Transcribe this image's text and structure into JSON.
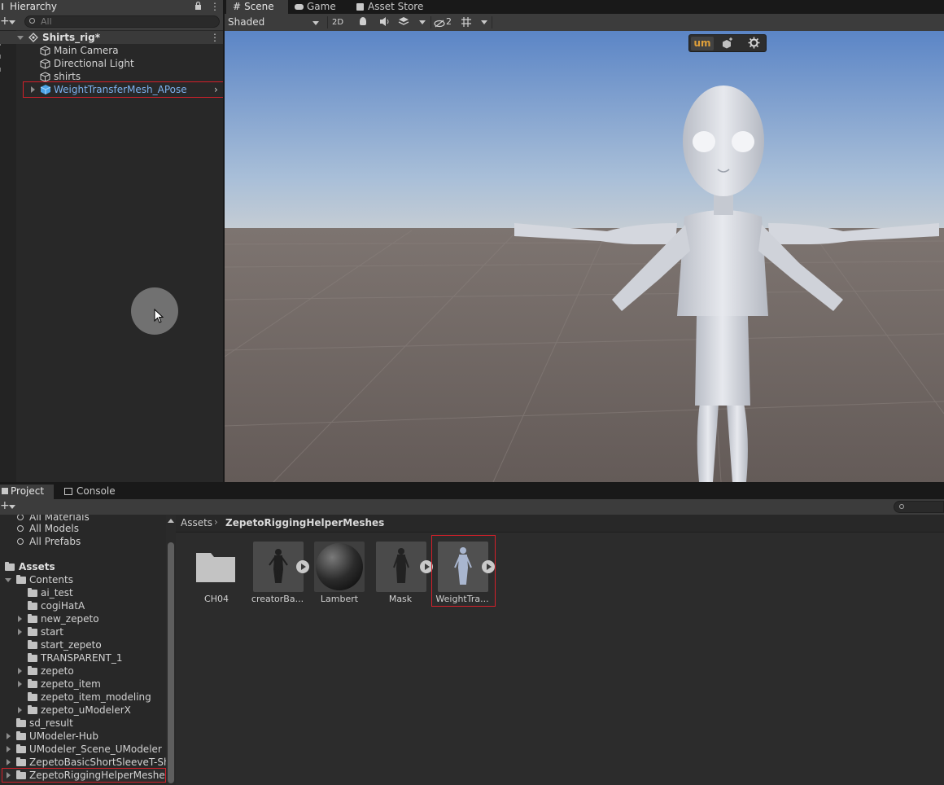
{
  "hierarchy": {
    "tab_label": "Hierarchy",
    "search_placeholder": "All",
    "scene_name": "Shirts_rig*",
    "items": [
      {
        "label": "Main Camera"
      },
      {
        "label": "Directional Light"
      },
      {
        "label": "shirts"
      },
      {
        "label": "WeightTransferMesh_APose"
      }
    ]
  },
  "scene_view": {
    "tabs": [
      {
        "label": "Scene"
      },
      {
        "label": "Game"
      },
      {
        "label": "Asset Store"
      }
    ],
    "shading_mode": "Shaded",
    "toggle_2d": "2D",
    "hidden_count": "2",
    "overlay_logo": "um"
  },
  "project": {
    "tabs": [
      {
        "label": "Project"
      },
      {
        "label": "Console"
      }
    ],
    "favorites": [
      {
        "label": "All Materials"
      },
      {
        "label": "All Models"
      },
      {
        "label": "All Prefabs"
      }
    ],
    "assets_root": "Assets",
    "tree": [
      {
        "label": "Contents"
      },
      {
        "label": "ai_test"
      },
      {
        "label": "cogiHatA"
      },
      {
        "label": "new_zepeto"
      },
      {
        "label": "start"
      },
      {
        "label": "start_zepeto"
      },
      {
        "label": "TRANSPARENT_1"
      },
      {
        "label": "zepeto"
      },
      {
        "label": "zepeto_item"
      },
      {
        "label": "zepeto_item_modeling"
      },
      {
        "label": "zepeto_uModelerX"
      },
      {
        "label": "sd_result"
      },
      {
        "label": "UModeler-Hub"
      },
      {
        "label": "UModeler_Scene_UModeler"
      },
      {
        "label": "ZepetoBasicShortSleeveT-Sh"
      },
      {
        "label": "ZepetoRiggingHelperMeshes"
      }
    ],
    "breadcrumb": [
      "Assets",
      "ZepetoRiggingHelperMeshes"
    ],
    "assets": [
      {
        "label": "CH04"
      },
      {
        "label": "creatorBa..."
      },
      {
        "label": "Lambert"
      },
      {
        "label": "Mask"
      },
      {
        "label": "WeightTra..."
      }
    ]
  },
  "colors": {
    "accent_selected": "#7cb2f0",
    "highlight_box": "#d4202a",
    "sky_top": "#5b85c6",
    "ground": "#6f6662"
  }
}
